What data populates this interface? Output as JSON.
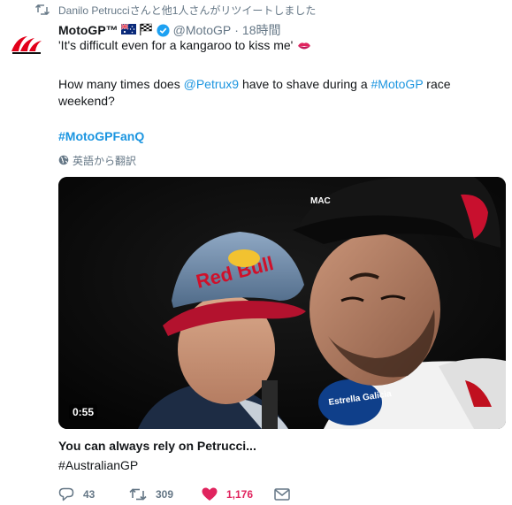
{
  "retweet_context": {
    "text": "Danilo Petrucciさんと他1人さんがリツイートしました"
  },
  "tweet": {
    "author_name": "MotoGP™",
    "handle": "@MotoGP",
    "separator": "·",
    "time": "18時間",
    "text_line1": "'It's difficult even for a kangaroo to kiss me'",
    "text_line2_pre": "How many times does ",
    "mention": "@Petrux9",
    "text_line2_mid": " have to shave during a ",
    "hashtag_motogp": "#MotoGP",
    "text_line2_post": " race",
    "text_line3": "weekend?",
    "hashtag_fanq": "#MotoGPFanQ",
    "translate_label": "英語から翻訳"
  },
  "media": {
    "duration": "0:55",
    "cap_text": "Red Bull",
    "shirt_text": "Estrella Galicia",
    "card_title": "You can always rely on Petrucci...",
    "card_subtitle": "#AustralianGP"
  },
  "actions": {
    "replies": "43",
    "retweets": "309",
    "likes": "1,176"
  },
  "icons": {
    "retweet": "retweet-icon",
    "verified": "verified-badge-icon",
    "globe": "globe-icon",
    "reply": "reply-icon",
    "like": "heart-icon",
    "dm": "envelope-icon",
    "lips": "kiss-mark-emoji",
    "flags": [
      "australia-flag-emoji",
      "checkered-flag-emoji"
    ]
  },
  "colors": {
    "link": "#1b95e0",
    "muted": "#657786",
    "like": "#e0245e",
    "brand_red": "#e2001a"
  }
}
